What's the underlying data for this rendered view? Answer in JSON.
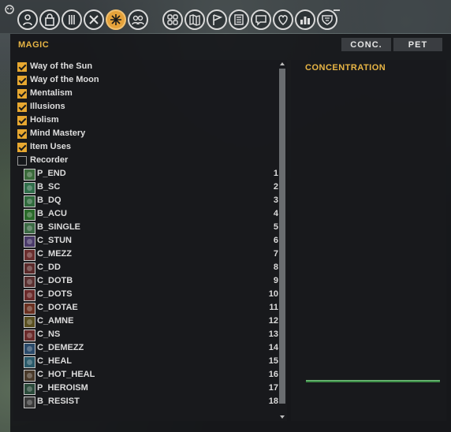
{
  "toolbar": {
    "left_icons": [
      {
        "name": "character-icon"
      },
      {
        "name": "inventory-bag-icon"
      },
      {
        "name": "combat-style-icon"
      },
      {
        "name": "crossed-swords-icon"
      },
      {
        "name": "magic-spark-icon",
        "active": true
      },
      {
        "name": "group-icon"
      }
    ],
    "right_icons": [
      {
        "name": "grid-icon"
      },
      {
        "name": "map-icon"
      },
      {
        "name": "flag-icon"
      },
      {
        "name": "journal-icon"
      },
      {
        "name": "chat-icon"
      },
      {
        "name": "heart-icon"
      },
      {
        "name": "stats-icon"
      },
      {
        "name": "shield-icon"
      }
    ]
  },
  "window": {
    "title": "MAGIC",
    "buttons": [
      "CONC.",
      "PET"
    ]
  },
  "categories": [
    {
      "label": "Way of the Sun",
      "checked": true
    },
    {
      "label": "Way of the Moon",
      "checked": true
    },
    {
      "label": "Mentalism",
      "checked": true
    },
    {
      "label": "Illusions",
      "checked": true
    },
    {
      "label": "Holism",
      "checked": true
    },
    {
      "label": "Mind Mastery",
      "checked": true
    },
    {
      "label": "Item Uses",
      "checked": true
    },
    {
      "label": "Recorder",
      "checked": false
    }
  ],
  "spells": [
    {
      "label": "P_END",
      "num": "1",
      "color": "#3a6a3a"
    },
    {
      "label": "B_SC",
      "num": "2",
      "color": "#2f6d4a"
    },
    {
      "label": "B_DQ",
      "num": "3",
      "color": "#2f6a3c"
    },
    {
      "label": "B_ACU",
      "num": "4",
      "color": "#2a6a2a"
    },
    {
      "label": "B_SINGLE",
      "num": "5",
      "color": "#3b6a44"
    },
    {
      "label": "C_STUN",
      "num": "6",
      "color": "#4a3a6a"
    },
    {
      "label": "C_MEZZ",
      "num": "7",
      "color": "#6a2e2e"
    },
    {
      "label": "C_DD",
      "num": "8",
      "color": "#5a2a2a"
    },
    {
      "label": "C_DOTB",
      "num": "9",
      "color": "#5a3030"
    },
    {
      "label": "C_DOTS",
      "num": "10",
      "color": "#6a2a2a"
    },
    {
      "label": "C_DOTAE",
      "num": "11",
      "color": "#6a3020"
    },
    {
      "label": "C_AMNE",
      "num": "12",
      "color": "#5a5020"
    },
    {
      "label": "C_NS",
      "num": "13",
      "color": "#6a2a2a"
    },
    {
      "label": "C_DEMEZZ",
      "num": "14",
      "color": "#2a4a6a"
    },
    {
      "label": "C_HEAL",
      "num": "15",
      "color": "#2a5a6a"
    },
    {
      "label": "C_HOT_HEAL",
      "num": "16",
      "color": "#4a3a2a"
    },
    {
      "label": "P_HEROISM",
      "num": "17",
      "color": "#2a4a3a"
    },
    {
      "label": "B_RESIST",
      "num": "18",
      "color": "#3a3a3a"
    }
  ],
  "right_panel": {
    "header": "CONCENTRATION"
  }
}
